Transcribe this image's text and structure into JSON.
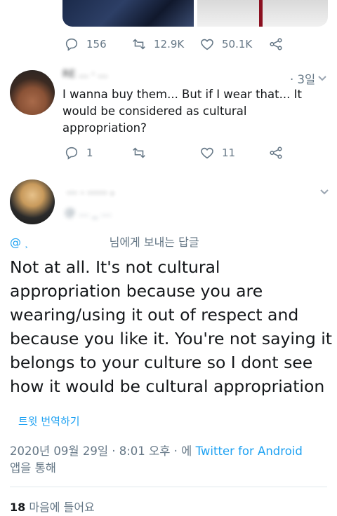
{
  "top_tweet": {
    "stats": {
      "replies": "156",
      "retweets": "12.9K",
      "likes": "50.1K"
    }
  },
  "reply1": {
    "author_blurred": "RE … · …",
    "time": "3일",
    "text": "I wanna buy them... But if I wear that... It would be considered as cultural appropriation?",
    "stats": {
      "replies": "1",
      "retweets": "",
      "likes": "11"
    }
  },
  "main_tweet": {
    "author_blurred": "… . ...... ,",
    "handle_blurred": "@ … _ …",
    "reply_to_suffix": "님에게 보내는 답글",
    "reply_to_prefix": "@ ˲",
    "text": "Not at all. It's not cultural appropriation because you are wearing/using it out of respect and because you like it. You're not saying it belongs to your culture so I dont see how it would be cultural appropriation",
    "translate_label": "트윗 번역하기",
    "timestamp": "2020년 09월 29일 · 8:01 오후 · 에",
    "source": "Twitter for Android",
    "source_suffix": "앱을 통해",
    "likes_count": "18",
    "likes_label": "마음에 들어요"
  }
}
